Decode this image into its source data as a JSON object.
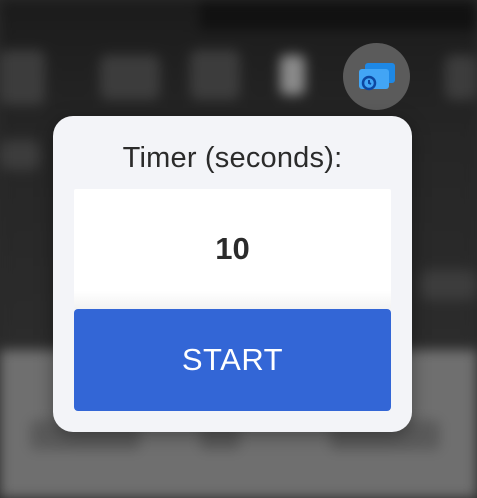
{
  "extension": {
    "icon": "cast-timer-icon",
    "accent": "#1e88e5"
  },
  "popup": {
    "label": "Timer (seconds):",
    "seconds_value": "10",
    "start_label": "START",
    "button_color": "#3366d6",
    "background": "#f3f4f8"
  }
}
